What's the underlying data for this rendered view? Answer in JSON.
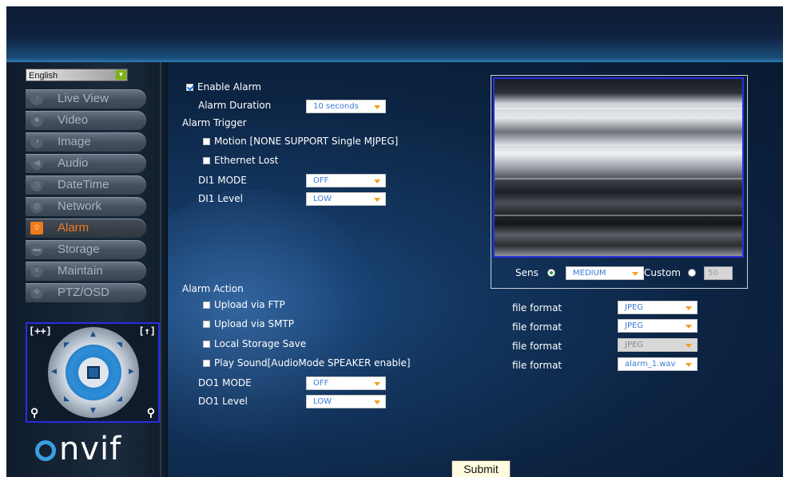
{
  "language": {
    "selected": "English"
  },
  "menu": [
    {
      "label": "Live View",
      "icon": "chat-bubble-icon"
    },
    {
      "label": "Video",
      "icon": "video-camera-icon"
    },
    {
      "label": "Image",
      "icon": "image-icon"
    },
    {
      "label": "Audio",
      "icon": "speaker-icon"
    },
    {
      "label": "DateTime",
      "icon": "clock-icon"
    },
    {
      "label": "Network",
      "icon": "globe-icon"
    },
    {
      "label": "Alarm",
      "icon": "star-icon",
      "active": true
    },
    {
      "label": "Storage",
      "icon": "storage-icon"
    },
    {
      "label": "Maintain",
      "icon": "tools-icon"
    },
    {
      "label": "PTZ/OSD",
      "icon": "ptz-icon"
    }
  ],
  "ptz": {
    "left_corner": "[++]",
    "right_corner": "[↑]"
  },
  "brand": {
    "logo_text": "nvif"
  },
  "alarm": {
    "enable_label": "Enable Alarm",
    "enable_checked": true,
    "duration_label": "Alarm Duration",
    "duration_value": "10 seconds",
    "trigger_heading": "Alarm Trigger",
    "triggers": [
      {
        "label": "Motion [NONE SUPPORT Single MJPEG]",
        "checked": false
      },
      {
        "label": "Ethernet Lost",
        "checked": false
      }
    ],
    "di1_mode_label": "DI1 MODE",
    "di1_mode_value": "OFF",
    "di1_level_label": "DI1 Level",
    "di1_level_value": "LOW"
  },
  "sensitivity": {
    "sens_label": "Sens",
    "sens_value": "MEDIUM",
    "custom_label": "Custom",
    "custom_value": "50"
  },
  "action": {
    "heading": "Alarm Action",
    "items": [
      {
        "label": "Upload via FTP",
        "format_label": "file format",
        "format_value": "JPEG",
        "disabled": false
      },
      {
        "label": "Upload via SMTP",
        "format_label": "file format",
        "format_value": "JPEG",
        "disabled": false
      },
      {
        "label": "Local Storage Save",
        "format_label": "file format",
        "format_value": "JPEG",
        "disabled": true
      },
      {
        "label": "Play Sound[AudioMode SPEAKER enable]",
        "format_label": "file format",
        "format_value": "alarm_1.wav",
        "disabled": false
      }
    ],
    "do1_mode_label": "DO1 MODE",
    "do1_mode_value": "OFF",
    "do1_level_label": "DO1 Level",
    "do1_level_value": "LOW"
  },
  "submit_label": "Submit"
}
